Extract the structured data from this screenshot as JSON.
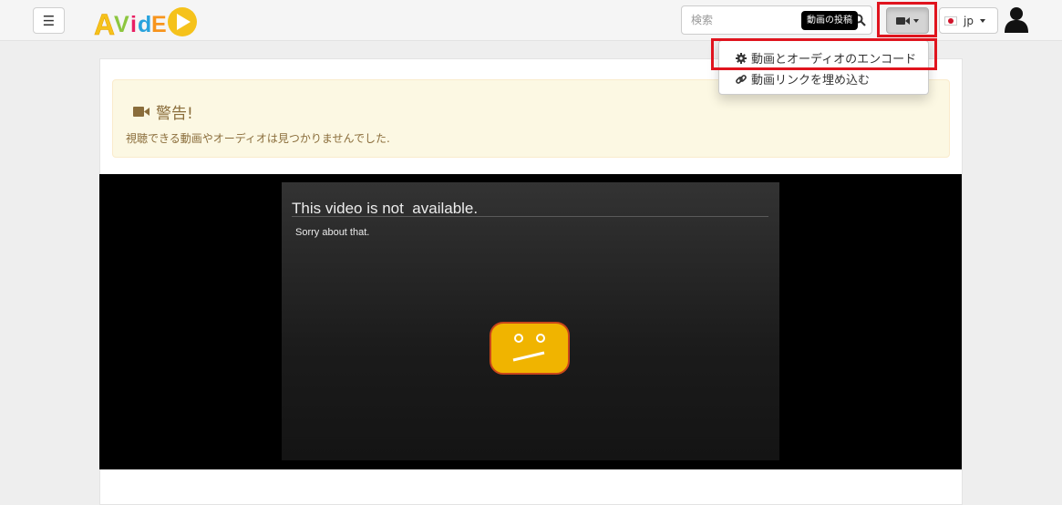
{
  "header": {
    "menu_icon": "hamburger-icon",
    "logo_text": "AVideo",
    "search": {
      "placeholder": "検索",
      "value": "",
      "icon": "search-icon"
    },
    "upload_tooltip": "動画の投稿",
    "upload_icon": "video-camera-icon",
    "language": {
      "selected": "jp",
      "flag": "japan-flag-icon"
    },
    "user_icon": "user-silhouette-icon"
  },
  "upload_menu": {
    "items": [
      {
        "icon": "gear-icon",
        "label": "動画とオーディオのエンコード"
      },
      {
        "icon": "link-icon",
        "label": "動画リンクを埋め込む"
      }
    ]
  },
  "alert": {
    "icon": "video-camera-icon",
    "title": "警告!",
    "message": "視聴できる動画やオーディオは見つかりませんでした."
  },
  "player": {
    "title": "This video is not  available.",
    "subtitle": "Sorry about that.",
    "icon": "sad-tv-face-icon"
  },
  "colors": {
    "highlight": "#e0141e",
    "alert_bg": "#fcf8e3",
    "alert_text": "#8a6d3b",
    "player_icon": "#f0b400"
  }
}
